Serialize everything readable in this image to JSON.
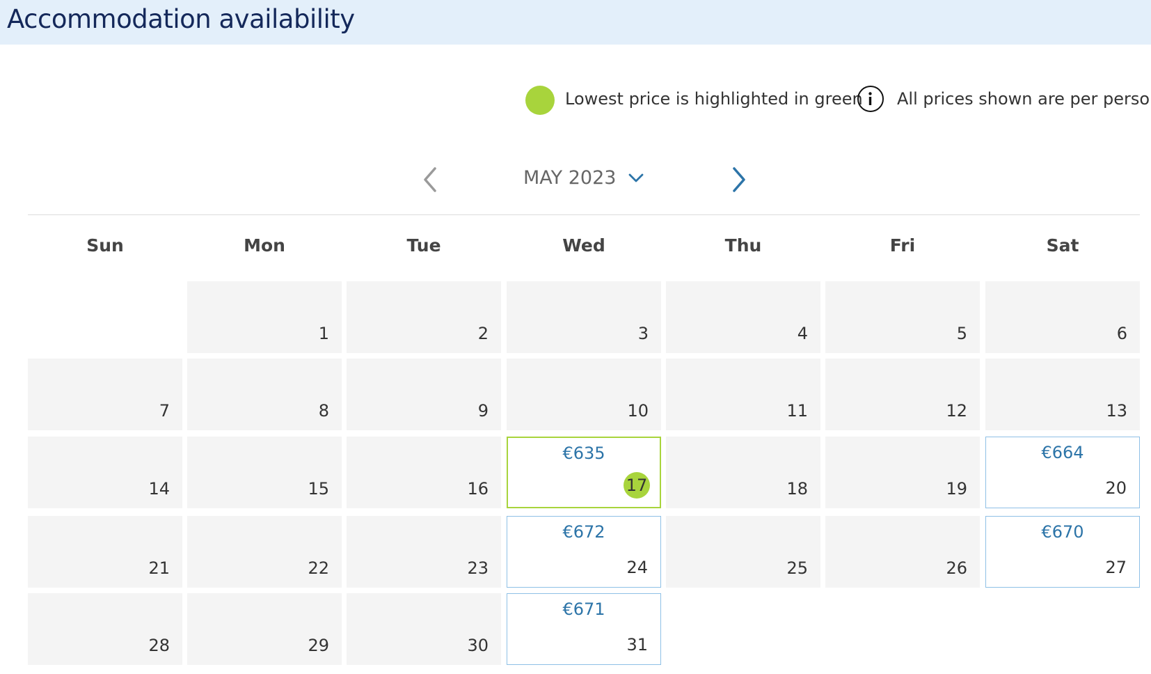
{
  "header": {
    "title": "Accommodation availability"
  },
  "legend": {
    "lowest_text": "Lowest price is highlighted in green",
    "info_text": "All prices shown are per person",
    "lowest_color": "#a8d43c"
  },
  "nav": {
    "month_label": "MAY 2023",
    "prev_icon": "chevron-left-icon",
    "next_icon": "chevron-right-icon",
    "dropdown_icon": "chevron-down-icon"
  },
  "weekdays": [
    "Sun",
    "Mon",
    "Tue",
    "Wed",
    "Thu",
    "Fri",
    "Sat"
  ],
  "days": [
    {
      "day": "1"
    },
    {
      "day": "2"
    },
    {
      "day": "3"
    },
    {
      "day": "4"
    },
    {
      "day": "5"
    },
    {
      "day": "6"
    },
    {
      "day": "7"
    },
    {
      "day": "8"
    },
    {
      "day": "9"
    },
    {
      "day": "10"
    },
    {
      "day": "11"
    },
    {
      "day": "12"
    },
    {
      "day": "13"
    },
    {
      "day": "14"
    },
    {
      "day": "15"
    },
    {
      "day": "16"
    },
    {
      "day": "17",
      "price": "€635",
      "lowest": true
    },
    {
      "day": "18"
    },
    {
      "day": "19"
    },
    {
      "day": "20",
      "price": "€664"
    },
    {
      "day": "21"
    },
    {
      "day": "22"
    },
    {
      "day": "23"
    },
    {
      "day": "24",
      "price": "€672"
    },
    {
      "day": "25"
    },
    {
      "day": "26"
    },
    {
      "day": "27",
      "price": "€670"
    },
    {
      "day": "28"
    },
    {
      "day": "29"
    },
    {
      "day": "30"
    },
    {
      "day": "31",
      "price": "€671"
    }
  ],
  "colors": {
    "price": "#2c74a8",
    "accent_blue": "#2c74a8",
    "header_bg": "#e3effa"
  }
}
